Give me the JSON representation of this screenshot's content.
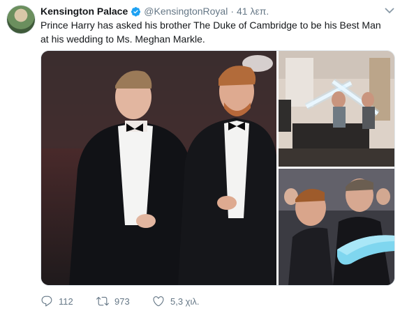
{
  "tweet": {
    "author_name": "Kensington Palace",
    "author_handle": "@KensingtonRoyal",
    "separator": "·",
    "time": "41 λεπ.",
    "text": "Prince Harry has asked his brother The Duke of Cambridge to be his Best Man at his wedding to Ms. Meghan Markle.",
    "replies": "112",
    "retweets": "973",
    "likes": "5,3 χιλ."
  },
  "colors": {
    "verified_blue": "#1da1f2",
    "muted_text": "#657786",
    "text": "#14171a"
  },
  "icons": {
    "verified": "verified-badge-icon",
    "menu": "chevron-down-icon",
    "reply": "reply-icon",
    "retweet": "retweet-icon",
    "like": "heart-icon"
  }
}
